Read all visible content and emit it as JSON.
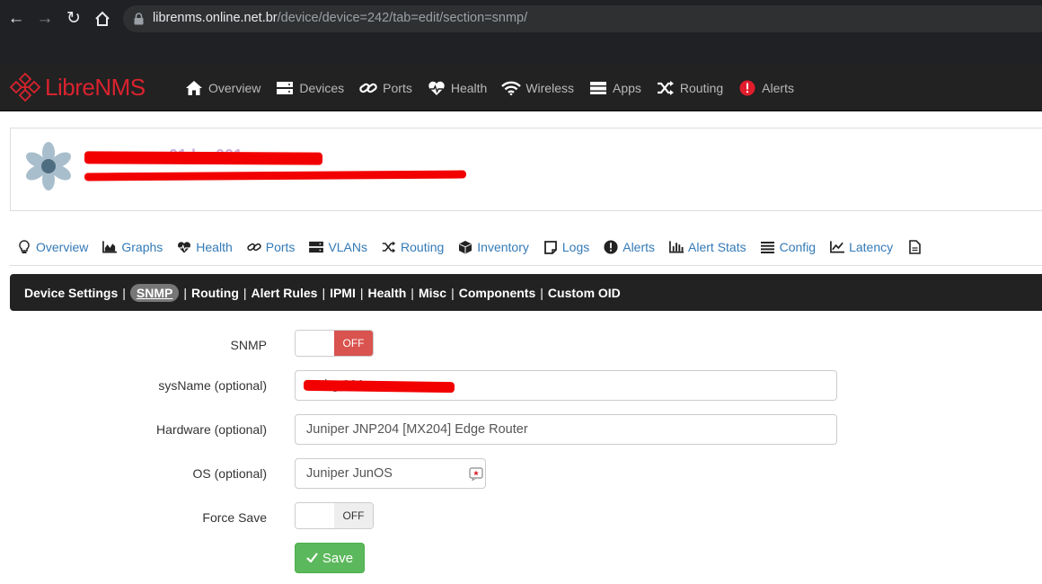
{
  "browser": {
    "url_host": "librenms.online.net.br",
    "url_path": "/device/device=242/tab=edit/section=snmp/"
  },
  "app": {
    "brand_libre": "Libre",
    "brand_nms": "NMS",
    "nav": [
      {
        "label": "Overview",
        "icon": "home-icon"
      },
      {
        "label": "Devices",
        "icon": "server-icon"
      },
      {
        "label": "Ports",
        "icon": "link-icon"
      },
      {
        "label": "Health",
        "icon": "heartbeat-icon"
      },
      {
        "label": "Wireless",
        "icon": "wifi-icon"
      },
      {
        "label": "Apps",
        "icon": "tasks-icon"
      },
      {
        "label": "Routing",
        "icon": "random-icon"
      },
      {
        "label": "Alerts",
        "icon": "alert-circle-icon"
      }
    ]
  },
  "device": {
    "hostname_fragment": "01 bg 001"
  },
  "device_tabs": [
    {
      "label": "Overview",
      "icon": "lightbulb-icon"
    },
    {
      "label": "Graphs",
      "icon": "area-chart-icon"
    },
    {
      "label": "Health",
      "icon": "heartbeat-icon"
    },
    {
      "label": "Ports",
      "icon": "link-icon"
    },
    {
      "label": "VLANs",
      "icon": "server-icon"
    },
    {
      "label": "Routing",
      "icon": "random-icon"
    },
    {
      "label": "Inventory",
      "icon": "cube-icon"
    },
    {
      "label": "Logs",
      "icon": "sticky-note-icon"
    },
    {
      "label": "Alerts",
      "icon": "exclamation-circle-icon"
    },
    {
      "label": "Alert Stats",
      "icon": "bar-chart-icon"
    },
    {
      "label": "Config",
      "icon": "align-justify-icon"
    },
    {
      "label": "Latency",
      "icon": "line-chart-icon"
    },
    {
      "label": "",
      "icon": "file-icon"
    }
  ],
  "sections": [
    "Device Settings",
    "SNMP",
    "Routing",
    "Alert Rules",
    "IPMI",
    "Health",
    "Misc",
    "Components",
    "Custom OID"
  ],
  "sections_active_index": 1,
  "form": {
    "snmp_label": "SNMP",
    "snmp_state": "OFF",
    "sysname_label": "sysName (optional)",
    "sysname_value": "01 bg 001",
    "hardware_label": "Hardware (optional)",
    "hardware_value": "Juniper JNP204 [MX204] Edge Router",
    "os_label": "OS (optional)",
    "os_value": "Juniper JunOS",
    "force_save_label": "Force Save",
    "force_save_state": "OFF",
    "save_label": "Save"
  }
}
